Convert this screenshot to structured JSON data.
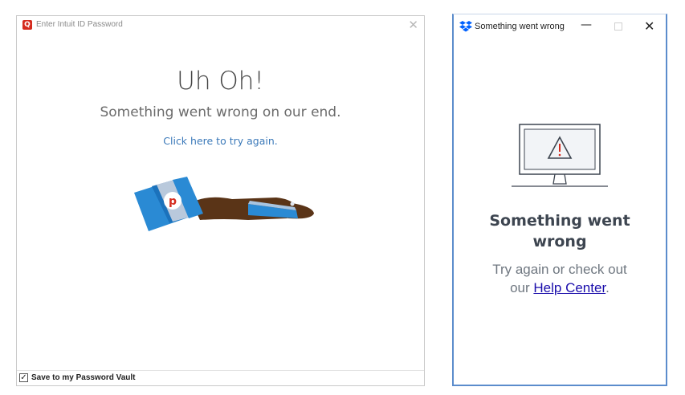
{
  "intuit_window": {
    "title": "Enter Intuit ID Password",
    "logo_letter": "Q",
    "heading": "Uh Oh!",
    "subheading": "Something went wrong on our end.",
    "retry_link": "Click here to try again.",
    "save_checkbox_label": "Save to my Password Vault",
    "save_checked": true,
    "close_icon": "close-icon"
  },
  "dropbox_window": {
    "title": "Something went wrong",
    "heading_line1": "Something went",
    "heading_line2": "wrong",
    "body_prefix_line1": "Try again or check out",
    "body_prefix_line2": "our ",
    "help_link": "Help Center",
    "body_suffix": ".",
    "icons": [
      "dropbox-icon",
      "minimize-icon",
      "maximize-icon",
      "close-icon",
      "monitor-warning-icon"
    ]
  },
  "colors": {
    "intuit_red": "#d52b1e",
    "link_blue": "#3b79b9",
    "dropbox_blue": "#0061fe",
    "help_link": "#1a0dab"
  }
}
